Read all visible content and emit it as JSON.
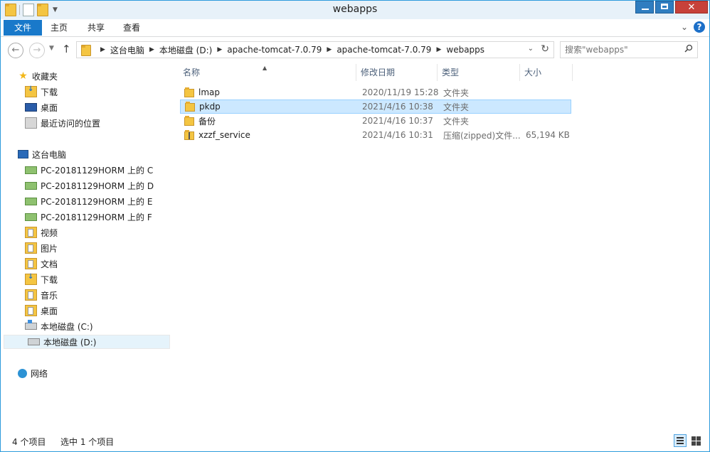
{
  "window": {
    "title": "webapps",
    "colors": {
      "accent": "#1979ca",
      "selection": "#cce8ff",
      "close": "#c7413a"
    }
  },
  "ribbon": {
    "tabs": [
      {
        "label": "文件"
      },
      {
        "label": "主页"
      },
      {
        "label": "共享"
      },
      {
        "label": "查看"
      }
    ]
  },
  "address": {
    "crumbs": [
      "这台电脑",
      "本地磁盘 (D:)",
      "apache-tomcat-7.0.79",
      "apache-tomcat-7.0.79",
      "webapps"
    ]
  },
  "search": {
    "placeholder": "搜索\"webapps\""
  },
  "nav": {
    "favorites": {
      "label": "收藏夹"
    },
    "favorite_items": [
      {
        "label": "下载",
        "icon": "download-folder-icon"
      },
      {
        "label": "桌面",
        "icon": "desktop-icon"
      },
      {
        "label": "最近访问的位置",
        "icon": "recent-places-icon"
      }
    ],
    "this_pc": {
      "label": "这台电脑"
    },
    "pc_items": [
      {
        "label": "PC-20181129HORM 上的 C",
        "icon": "network-drive-icon"
      },
      {
        "label": "PC-20181129HORM 上的 D",
        "icon": "network-drive-icon"
      },
      {
        "label": "PC-20181129HORM 上的 E",
        "icon": "network-drive-icon"
      },
      {
        "label": "PC-20181129HORM 上的 F",
        "icon": "network-drive-icon"
      },
      {
        "label": "视频",
        "icon": "videos-folder-icon"
      },
      {
        "label": "图片",
        "icon": "pictures-folder-icon"
      },
      {
        "label": "文档",
        "icon": "documents-folder-icon"
      },
      {
        "label": "下载",
        "icon": "download-folder-icon"
      },
      {
        "label": "音乐",
        "icon": "music-folder-icon"
      },
      {
        "label": "桌面",
        "icon": "desktop-folder-icon"
      },
      {
        "label": "本地磁盘 (C:)",
        "icon": "system-drive-icon"
      },
      {
        "label": "本地磁盘 (D:)",
        "icon": "local-drive-icon"
      }
    ],
    "network": {
      "label": "网络"
    }
  },
  "table": {
    "columns": [
      "名称",
      "修改日期",
      "类型",
      "大小"
    ],
    "rows": [
      {
        "name": "lmap",
        "date": "2020/11/19 15:28",
        "type": "文件夹",
        "size": ""
      },
      {
        "name": "pkdp",
        "date": "2021/4/16 10:38",
        "type": "文件夹",
        "size": ""
      },
      {
        "name": "备份",
        "date": "2021/4/16 10:37",
        "type": "文件夹",
        "size": ""
      },
      {
        "name": "xzzf_service",
        "date": "2021/4/16 10:31",
        "type": "压缩(zipped)文件...",
        "size": "65,194 KB"
      }
    ]
  },
  "status": {
    "count": "4 个项目",
    "selected": "选中 1 个项目"
  }
}
